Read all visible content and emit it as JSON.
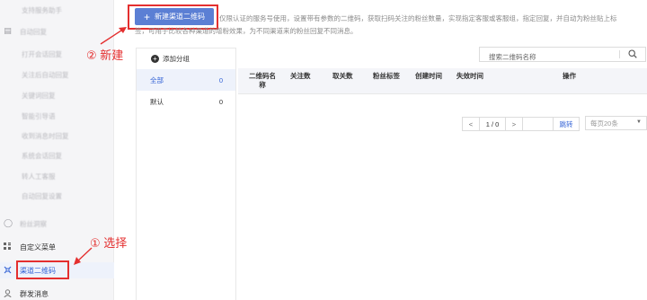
{
  "sidebar": {
    "items": [
      {
        "label": "支持服务助手",
        "sub": true,
        "clear": false
      },
      {
        "label": "自动回复",
        "sub": false,
        "clear": false,
        "icon": "chat-icon"
      },
      {
        "label": "打开会话回复",
        "sub": true,
        "clear": false
      },
      {
        "label": "关注后自动回复",
        "sub": true,
        "clear": false
      },
      {
        "label": "关键词回复",
        "sub": true,
        "clear": false
      },
      {
        "label": "智能引导语",
        "sub": true,
        "clear": false
      },
      {
        "label": "收到消息时回复",
        "sub": true,
        "clear": false
      },
      {
        "label": "系统会话回复",
        "sub": true,
        "clear": false
      },
      {
        "label": "转人工客服",
        "sub": true,
        "clear": false
      },
      {
        "label": "自动回复设置",
        "sub": true,
        "clear": false
      },
      {
        "label": "粉丝洞察",
        "sub": false,
        "clear": false,
        "icon": "fans-icon"
      },
      {
        "label": "自定义菜单",
        "sub": false,
        "clear": true,
        "icon": "menu-grid-icon"
      },
      {
        "label": "渠道二维码",
        "sub": false,
        "clear": true,
        "icon": "qrcode-icon",
        "active": true
      },
      {
        "label": "群发消息",
        "sub": false,
        "clear": true,
        "icon": "user-icon"
      }
    ]
  },
  "annotations": {
    "step1": "① 选择",
    "step2": "② 新建"
  },
  "toolbar": {
    "new_button_label": "新建渠道二维码",
    "new_button_icon": "plus-icon"
  },
  "description": {
    "line1": "仅限认证的服务号使用，设置带有参数的二维码，获取扫码关注的粉丝数量，实现指定客服或客服组，指定回复，并自动为粉丝贴上标",
    "line2": "签，可用于比较各种渠道的增粉效果，为不同渠道来的粉丝回复不同消息。"
  },
  "groups": {
    "add_label": "添加分组",
    "rows": [
      {
        "name": "全部",
        "count": "0",
        "active": true
      },
      {
        "name": "默认",
        "count": "0",
        "active": false
      }
    ]
  },
  "search": {
    "placeholder": "搜索二维码名称"
  },
  "table": {
    "columns": [
      "二维码名称",
      "关注数",
      "取关数",
      "粉丝标签",
      "创建时间",
      "失效时间",
      "操作"
    ]
  },
  "pager": {
    "prev": "<",
    "page_info": "1 / 0",
    "next": ">",
    "jump_value": "",
    "jump_label": "跳转",
    "per_page": "每页20条"
  },
  "colors": {
    "accent": "#5b7fd4",
    "annotation_red": "#e42f2f",
    "active_text": "#3564d6"
  }
}
